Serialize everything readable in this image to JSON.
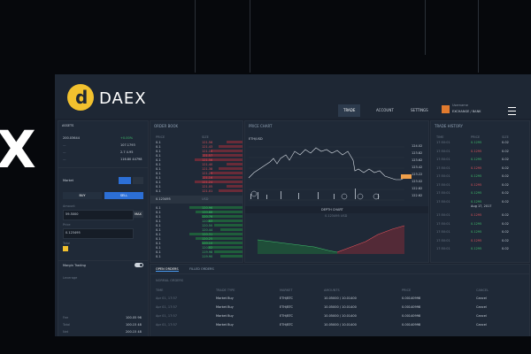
{
  "branding": {
    "logo_letter": "d",
    "name": "DAEX",
    "logo_color": "#f2c12e"
  },
  "overlay": {
    "big_letter": "X"
  },
  "nav": {
    "items": [
      {
        "label": "TRADE",
        "active": true
      },
      {
        "label": "ACCOUNT",
        "active": false
      },
      {
        "label": "SETTINGS",
        "active": false
      }
    ]
  },
  "account": {
    "line1": "Username",
    "line2": "EXCHANGE / BANK"
  },
  "wallet": {
    "select_label": "ASSETS",
    "balance_label": "200.03644",
    "change": "+0.00%",
    "rows": [
      {
        "k": "—",
        "v": "107.1793"
      },
      {
        "k": "—",
        "v": "2.7 4.95"
      },
      {
        "k": "—",
        "v": "116.80 44798"
      }
    ]
  },
  "order_form": {
    "market_label": "Market",
    "buy_label": "BUY",
    "sell_label": "SELL",
    "amount_label": "Amount",
    "amount_value": "59.5000",
    "max_label": "MAX",
    "price_label": "Price",
    "price_value": "0.123495",
    "total_label": "Total",
    "margin_label": "Margin Trading",
    "leverage_label": "Leverage",
    "bottom_rows": [
      {
        "k": "Fee",
        "v": "100.05 96"
      },
      {
        "k": "Total",
        "v": "100.15 48"
      },
      {
        "k": "Net",
        "v": "200.15 48"
      }
    ]
  },
  "order_book": {
    "title": "ORDER BOOK",
    "cols": [
      "PRICE",
      "SIZE"
    ],
    "asks": [
      {
        "p": "0.1",
        "s": "121.56"
      },
      {
        "p": "0.1",
        "s": "121.43"
      },
      {
        "p": "0.1",
        "s": "121.10"
      },
      {
        "p": "0.1",
        "s": "121.57"
      },
      {
        "p": "0.1",
        "s": "121.56"
      },
      {
        "p": "0.1",
        "s": "121.40"
      },
      {
        "p": "0.1",
        "s": "121.38"
      },
      {
        "p": "0.1",
        "s": "121.29"
      },
      {
        "p": "0.1",
        "s": "121.16"
      },
      {
        "p": "0.1",
        "s": "121.24"
      },
      {
        "p": "0.1",
        "s": "121.05"
      },
      {
        "p": "0.1",
        "s": "121.01"
      }
    ],
    "spread_label": "0.123495",
    "spread_sub": "USD",
    "bids": [
      {
        "p": "0.1",
        "s": "120.96"
      },
      {
        "p": "0.1",
        "s": "120.88"
      },
      {
        "p": "0.1",
        "s": "120.76"
      },
      {
        "p": "0.1",
        "s": "120.63"
      },
      {
        "p": "0.1",
        "s": "120.50"
      },
      {
        "p": "0.1",
        "s": "120.44"
      },
      {
        "p": "0.1",
        "s": "120.31"
      },
      {
        "p": "0.1",
        "s": "120.25"
      },
      {
        "p": "0.1",
        "s": "120.10"
      },
      {
        "p": "0.1",
        "s": "120.02"
      },
      {
        "p": "0.1",
        "s": "119.98"
      },
      {
        "p": "0.1",
        "s": "119.90"
      }
    ]
  },
  "price_chart": {
    "title": "PRICE CHART",
    "pair": "ETH/USD",
    "price_tag": "0.123495",
    "y_ticks": [
      "124.02",
      "123.82",
      "123.62",
      "123.42",
      "123.22",
      "123.02",
      "122.82",
      "122.62"
    ],
    "depth_label": "DEPTH CHART",
    "depth_sub": "0.123495 USD"
  },
  "trade_history": {
    "title": "TRADE HISTORY",
    "cols": [
      "TIME",
      "PRICE",
      "SIZE"
    ],
    "date_label": "Aug 17, 2017",
    "rows": [
      {
        "t": "17:50:01",
        "p": "0.1295",
        "s": "0.02",
        "c": "g"
      },
      {
        "t": "17:50:01",
        "p": "0.1295",
        "s": "0.02",
        "c": "r"
      },
      {
        "t": "17:50:01",
        "p": "0.1295",
        "s": "0.02",
        "c": "g"
      },
      {
        "t": "17:50:01",
        "p": "0.1295",
        "s": "0.02",
        "c": "r"
      },
      {
        "t": "17:50:01",
        "p": "0.1295",
        "s": "0.02",
        "c": "g"
      },
      {
        "t": "17:50:01",
        "p": "0.1295",
        "s": "0.02",
        "c": "r"
      },
      {
        "t": "17:50:01",
        "p": "0.1295",
        "s": "0.02",
        "c": "g"
      },
      {
        "t": "17:50:01",
        "p": "0.1295",
        "s": "0.02",
        "c": "g"
      },
      {
        "t": "17:50:01",
        "p": "0.1295",
        "s": "0.02",
        "c": "r"
      },
      {
        "t": "17:50:01",
        "p": "0.1295",
        "s": "0.02",
        "c": "g"
      },
      {
        "t": "17:50:01",
        "p": "0.1295",
        "s": "0.02",
        "c": "g"
      },
      {
        "t": "17:50:01",
        "p": "0.1295",
        "s": "0.02",
        "c": "r"
      },
      {
        "t": "17:50:01",
        "p": "0.1295",
        "s": "0.02",
        "c": "g"
      },
      {
        "t": "17:50:01",
        "p": "0.1295",
        "s": "0.02",
        "c": "r"
      }
    ]
  },
  "orders": {
    "tabs": [
      "OPEN ORDERS",
      "FILLED ORDERS"
    ],
    "filter": "NORMAL ORDERS",
    "cols": [
      "TIME",
      "TRADE TYPE",
      "MARKET",
      "AMOUNTS",
      "PRICE",
      "CANCEL"
    ],
    "rows": [
      {
        "time": "Apr 01, 17:57",
        "type": "Market Buy",
        "market": "ETH/BTC",
        "amount": "10.05000 / 10.01400",
        "price": "0.00140998",
        "cancel": "Cancel"
      },
      {
        "time": "Apr 01, 17:57",
        "type": "Market Buy",
        "market": "ETH/BTC",
        "amount": "10.05000 / 10.01400",
        "price": "0.00140998",
        "cancel": "Cancel"
      },
      {
        "time": "Apr 01, 17:57",
        "type": "Market Buy",
        "market": "ETH/BTC",
        "amount": "10.05000 / 10.01400",
        "price": "0.00140998",
        "cancel": "Cancel"
      },
      {
        "time": "Apr 01, 17:57",
        "type": "Market Buy",
        "market": "ETH/BTC",
        "amount": "10.05000 / 10.01400",
        "price": "0.00140998",
        "cancel": "Cancel"
      }
    ]
  },
  "colors": {
    "bg": "#06080c",
    "app": "#1b2330",
    "panel": "#1f2937",
    "up": "#3fbf6c",
    "down": "#e0525b",
    "accent": "#4a9bf0",
    "price_tag": "#f0a04b"
  }
}
